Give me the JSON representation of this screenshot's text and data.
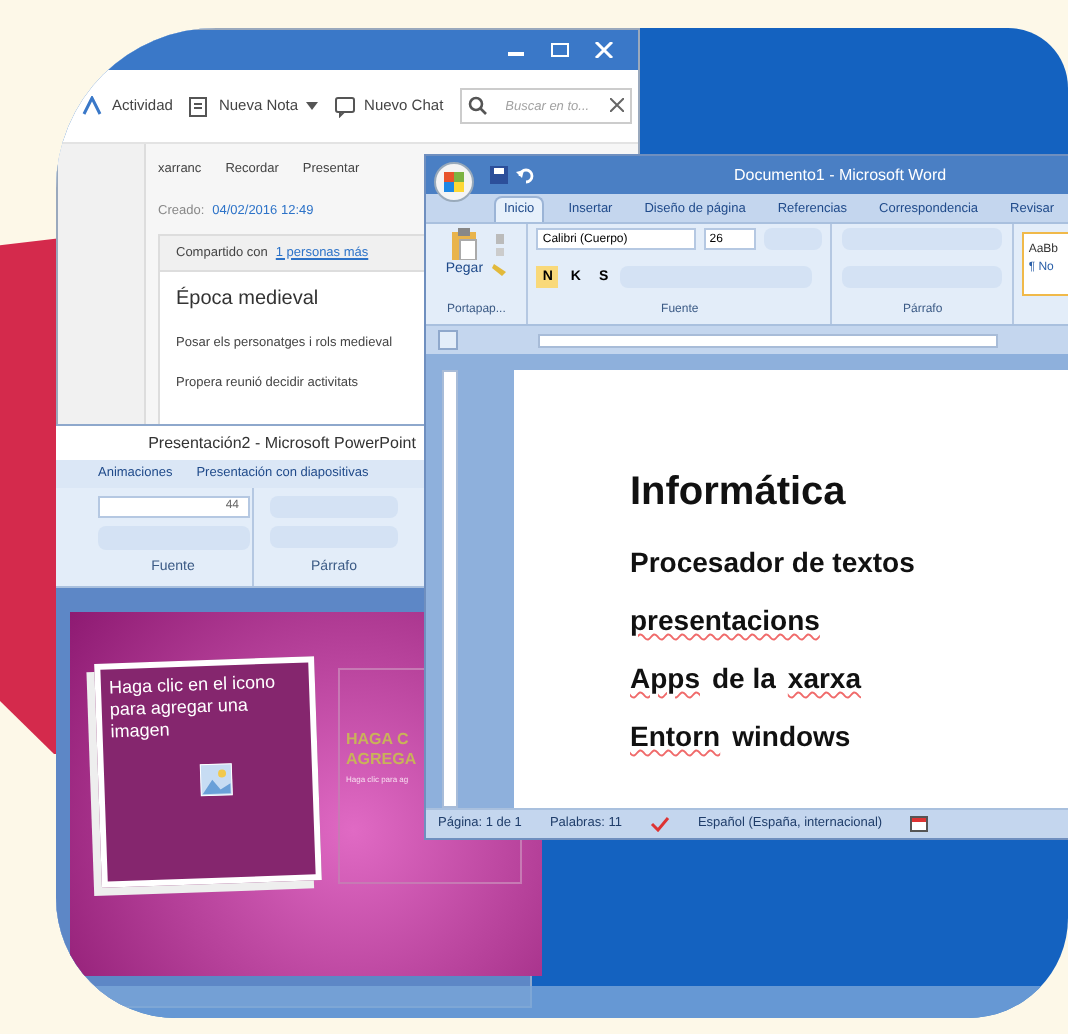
{
  "notes_window": {
    "toolbar": [
      "Actividad",
      "Nueva Nota",
      "Nuevo Chat"
    ],
    "search_placeholder": "Buscar en to...",
    "note_actions": [
      "xarranc",
      "Recordar",
      "Presentar"
    ],
    "created_label": "Creado:",
    "created_value": "04/02/2016 12:49",
    "shared_text": "Compartido con",
    "shared_link": "1 personas más",
    "note_title": "Época medieval",
    "note_lines": [
      "Posar els personatges i rols medieval",
      "Propera reunió decidir activitats"
    ]
  },
  "powerpoint": {
    "title": "Presentación2 - Microsoft PowerPoint",
    "tabs": [
      "Animaciones",
      "Presentación con diapositivas"
    ],
    "font_size": "44",
    "groups": [
      "Fuente",
      "Párrafo"
    ],
    "slide": {
      "image_placeholder": "Haga clic en el icono para agregar una imagen",
      "title_lines": [
        "HAGA C",
        "AGREGA"
      ],
      "subtitle": "Haga clic para ag"
    }
  },
  "word": {
    "title": "Documento1 - Microsoft Word",
    "tabs": [
      {
        "label": "Inicio",
        "selected": true
      },
      {
        "label": "Insertar",
        "selected": false
      },
      {
        "label": "Diseño de página",
        "selected": false
      },
      {
        "label": "Referencias",
        "selected": false
      },
      {
        "label": "Correspondencia",
        "selected": false
      },
      {
        "label": "Revisar",
        "selected": false
      }
    ],
    "paste": "Pegar",
    "font": "Calibri (Cuerpo)",
    "font_size": "26",
    "format_buttons": [
      "N",
      "K",
      "S"
    ],
    "style_preview": [
      "AaBb",
      "¶ No"
    ],
    "groups": [
      "Portapap...",
      "Fuente",
      "Párrafo"
    ],
    "document_lines": [
      [
        {
          "text": "Informática",
          "misspelled": false
        }
      ],
      [
        {
          "text": "Procesador de textos",
          "misspelled": false
        }
      ],
      [
        {
          "text": "presentacions",
          "misspelled": true
        }
      ],
      [
        {
          "text": "Apps",
          "misspelled": true
        },
        {
          "text": "de la",
          "misspelled": false
        },
        {
          "text": "xarxa",
          "misspelled": true
        }
      ],
      [
        {
          "text": "Entorn",
          "misspelled": true
        },
        {
          "text": "windows",
          "misspelled": false
        }
      ]
    ],
    "status": [
      "Página: 1 de 1",
      "Palabras: 11",
      "Español (España, internacional)"
    ]
  }
}
